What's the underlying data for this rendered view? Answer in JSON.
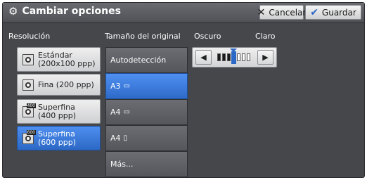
{
  "header": {
    "title": "Cambiar opciones",
    "cancel_label": "Cancelar",
    "save_label": "Guardar"
  },
  "resolution": {
    "label": "Resolución",
    "selected_index": 3,
    "items": [
      {
        "label_lines": [
          "Estándar",
          "(200x100 ppp)"
        ],
        "icon": "magnifier-standard-icon"
      },
      {
        "label_lines": [
          "Fina (200 ppp)"
        ],
        "icon": "magnifier-fine-icon"
      },
      {
        "label_lines": [
          "Superfina",
          "(400 ppp)"
        ],
        "icon": "magnifier-400-icon",
        "icon_tag": "400"
      },
      {
        "label_lines": [
          "Superfina",
          "(600 ppp)"
        ],
        "icon": "magnifier-600-icon",
        "icon_tag": "600"
      }
    ]
  },
  "original_size": {
    "label": "Tamaño del original",
    "selected_index": 1,
    "items": [
      {
        "label": "Autodetección"
      },
      {
        "label": "A3",
        "icon": "landscape-paper-icon"
      },
      {
        "label": "A4",
        "icon": "landscape-paper-icon"
      },
      {
        "label": "A4",
        "icon": "portrait-paper-icon"
      },
      {
        "label": "Más..."
      }
    ]
  },
  "density": {
    "dark_label": "Oscuro",
    "light_label": "Claro",
    "level": 4,
    "levels_total": 7,
    "colors": {
      "accent": "#2c68c5",
      "dark_bar": "#1a1a1a",
      "light_bar": "#ffffff"
    }
  }
}
